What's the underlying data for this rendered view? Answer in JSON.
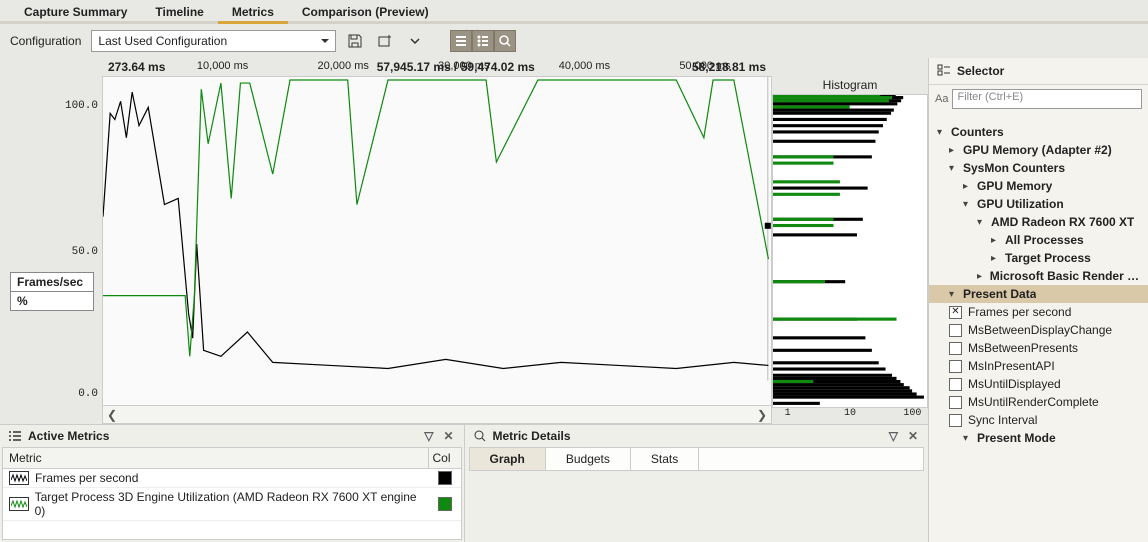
{
  "top_tabs": {
    "t0": "Capture Summary",
    "t1": "Timeline",
    "t2": "Metrics",
    "t3": "Comparison (Preview)",
    "active": 2
  },
  "config": {
    "label": "Configuration",
    "selected": "Last Used Configuration"
  },
  "chart": {
    "y_ticks": [
      "100.0",
      "50.0",
      "0.0"
    ],
    "y_label_title": "Frames/sec",
    "y_label_value": "%",
    "time_ticks": [
      "10,000 ms",
      "20,000 ms",
      "30,000 ms",
      "40,000 ms",
      "50,000 ms"
    ],
    "cursor_start": "273.64 ms",
    "cursor_mid": "57,945.17 ms / 59,474.02 ms",
    "cursor_end": "58,218.81 ms"
  },
  "histogram": {
    "title": "Histogram",
    "x_ticks": [
      "1",
      "10",
      "100"
    ]
  },
  "active_metrics_pane": {
    "title": "Active Metrics",
    "col1": "Metric",
    "col2": "Col",
    "rows": [
      {
        "label": "Frames per second",
        "color": "#000000"
      },
      {
        "label": "Target Process 3D Engine Utilization (AMD Radeon RX 7600 XT engine 0)",
        "color": "#0f8a0f"
      }
    ]
  },
  "metric_details_pane": {
    "title": "Metric Details",
    "tabs": [
      "Graph",
      "Budgets",
      "Stats"
    ]
  },
  "sidebar": {
    "title": "Selector",
    "filter_placeholder": "Filter (Ctrl+E)",
    "tree": {
      "counters": "Counters",
      "gpu_mem_adapter": "GPU Memory (Adapter #2)",
      "sysmon": "SysMon Counters",
      "gpu_mem": "GPU Memory",
      "gpu_util": "GPU Utilization",
      "amd": "AMD Radeon RX 7600 XT",
      "all_proc": "All Processes",
      "target_proc": "Target Process",
      "msbasic": "Microsoft Basic Render Driver",
      "present_data": "Present Data",
      "present_mode": "Present Mode"
    },
    "checks": {
      "fps": "Frames per second",
      "msbdc": "MsBetweenDisplayChange",
      "msbp": "MsBetweenPresents",
      "msipa": "MsInPresentAPI",
      "msud": "MsUntilDisplayed",
      "msurc": "MsUntilRenderComplete",
      "syncint": "Sync Interval"
    }
  },
  "chart_data": {
    "type": "line",
    "title": "",
    "xlabel": "ms",
    "ylabel": "% / Frames/sec",
    "ylim": [
      0,
      100
    ],
    "x_range_ms": [
      273.64,
      58218.81
    ],
    "cursor_ms": 57945.17,
    "selection_end_ms": 59474.02,
    "series": [
      {
        "name": "Frames per second",
        "color": "#000000",
        "x_ms": [
          275,
          900,
          1300,
          1800,
          2300,
          2800,
          3400,
          4200,
          5600,
          6800,
          7700,
          8050,
          8400,
          9000,
          10500,
          12800,
          15000,
          20000,
          25000,
          30000,
          35000,
          40000,
          45000,
          50000,
          55000,
          58000
        ],
        "values": [
          54,
          88,
          86,
          92,
          80,
          95,
          84,
          90,
          58,
          60,
          22,
          14,
          45,
          10,
          8,
          16,
          6,
          5,
          4,
          7,
          4,
          6,
          5,
          4,
          6,
          5
        ]
      },
      {
        "name": "Target Process 3D Engine Utilization (AMD Radeon RX 7600 XT engine 0)",
        "color": "#0f8a0f",
        "x_ms": [
          275,
          2000,
          4000,
          6000,
          7400,
          7800,
          8200,
          8800,
          9400,
          10500,
          11400,
          12200,
          13000,
          15000,
          16500,
          21500,
          22300,
          25000,
          33500,
          34400,
          38000,
          42000,
          46000,
          50000,
          52400,
          53200,
          55000,
          58000
        ],
        "values": [
          28,
          28,
          28,
          28,
          28,
          8,
          28,
          96,
          78,
          98,
          60,
          98,
          98,
          68,
          99,
          99,
          58,
          99,
          99,
          72,
          99,
          99,
          99,
          99,
          80,
          99,
          99,
          40
        ]
      }
    ],
    "histogram": {
      "type": "bar-horizontal",
      "x_scale": "log",
      "xlim": [
        1,
        200
      ],
      "series": [
        {
          "name": "Frames per second",
          "color": "#000000",
          "y_bins": [
            1,
            3,
            4,
            5,
            6,
            7,
            8,
            9,
            10,
            12,
            14,
            18,
            22,
            28,
            40,
            55,
            60,
            70,
            80,
            85,
            88,
            90,
            92,
            94,
            95,
            97,
            98,
            99,
            100
          ],
          "counts": [
            5,
            180,
            140,
            120,
            110,
            90,
            80,
            70,
            60,
            48,
            38,
            30,
            24,
            18,
            12,
            18,
            22,
            26,
            30,
            34,
            38,
            44,
            50,
            58,
            64,
            72,
            82,
            88,
            68
          ]
        },
        {
          "name": "Target Process 3D Engine Utilization",
          "color": "#0f8a0f",
          "y_bins": [
            8,
            28,
            40,
            58,
            60,
            68,
            72,
            78,
            80,
            96,
            98,
            99,
            100
          ],
          "counts": [
            4,
            70,
            6,
            8,
            8,
            10,
            10,
            8,
            8,
            14,
            54,
            60,
            40
          ]
        }
      ]
    }
  }
}
